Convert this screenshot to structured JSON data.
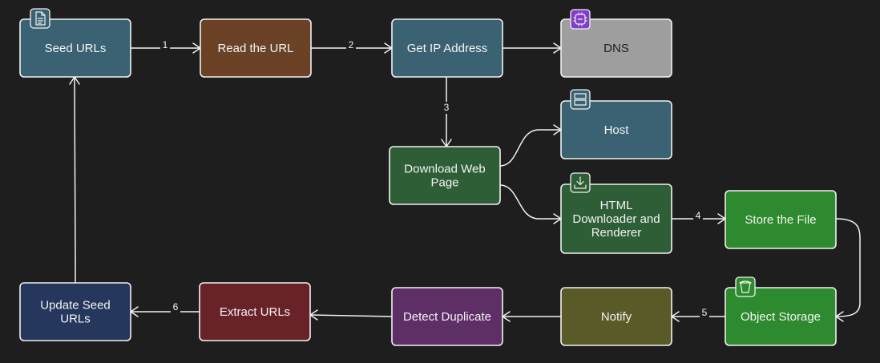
{
  "nodes": {
    "seed": {
      "label": [
        "Seed URLs"
      ],
      "color": "#3a6272"
    },
    "read": {
      "label": [
        "Read the URL"
      ],
      "color": "#6b4226"
    },
    "getip": {
      "label": [
        "Get IP Address"
      ],
      "color": "#3a6272"
    },
    "dns": {
      "label": [
        "DNS"
      ],
      "color": "#9e9e9e",
      "text_color": "#1e1e1e"
    },
    "download": {
      "label": [
        "Download Web",
        "Page"
      ],
      "color": "#2e5e36"
    },
    "host": {
      "label": [
        "Host"
      ],
      "color": "#3a6272"
    },
    "html": {
      "label": [
        "HTML",
        "Downloader and",
        "Renderer"
      ],
      "color": "#2e5e36"
    },
    "store": {
      "label": [
        "Store the File"
      ],
      "color": "#2e8a2e"
    },
    "objstore": {
      "label": [
        "Object Storage"
      ],
      "color": "#2e8a2e"
    },
    "notify": {
      "label": [
        "Notify"
      ],
      "color": "#5a5a28"
    },
    "detect": {
      "label": [
        "Detect Duplicate"
      ],
      "color": "#5e2e66"
    },
    "extract": {
      "label": [
        "Extract URLs"
      ],
      "color": "#6a2229"
    },
    "update": {
      "label": [
        "Update Seed",
        "URLs"
      ],
      "color": "#26375e"
    }
  },
  "edges": [
    {
      "from": "seed",
      "to": "read",
      "label": "1"
    },
    {
      "from": "read",
      "to": "getip",
      "label": "2"
    },
    {
      "from": "getip",
      "to": "dns",
      "label": ""
    },
    {
      "from": "getip",
      "to": "download",
      "label": "3"
    },
    {
      "from": "download",
      "to": "host",
      "label": ""
    },
    {
      "from": "download",
      "to": "html",
      "label": ""
    },
    {
      "from": "html",
      "to": "store",
      "label": "4"
    },
    {
      "from": "store",
      "to": "objstore",
      "label": ""
    },
    {
      "from": "objstore",
      "to": "notify",
      "label": "5"
    },
    {
      "from": "notify",
      "to": "detect",
      "label": ""
    },
    {
      "from": "detect",
      "to": "extract",
      "label": ""
    },
    {
      "from": "extract",
      "to": "update",
      "label": "6"
    },
    {
      "from": "update",
      "to": "seed",
      "label": ""
    }
  ],
  "icons": {
    "seed": {
      "name": "document-icon",
      "color": "#3a6272"
    },
    "dns": {
      "name": "dns-service-icon",
      "color": "#7e3fc9"
    },
    "host": {
      "name": "server-icon",
      "color": "#3a6272"
    },
    "html": {
      "name": "download-icon",
      "color": "#2e5e36"
    },
    "objstore": {
      "name": "bucket-icon",
      "color": "#2e8a2e"
    }
  }
}
